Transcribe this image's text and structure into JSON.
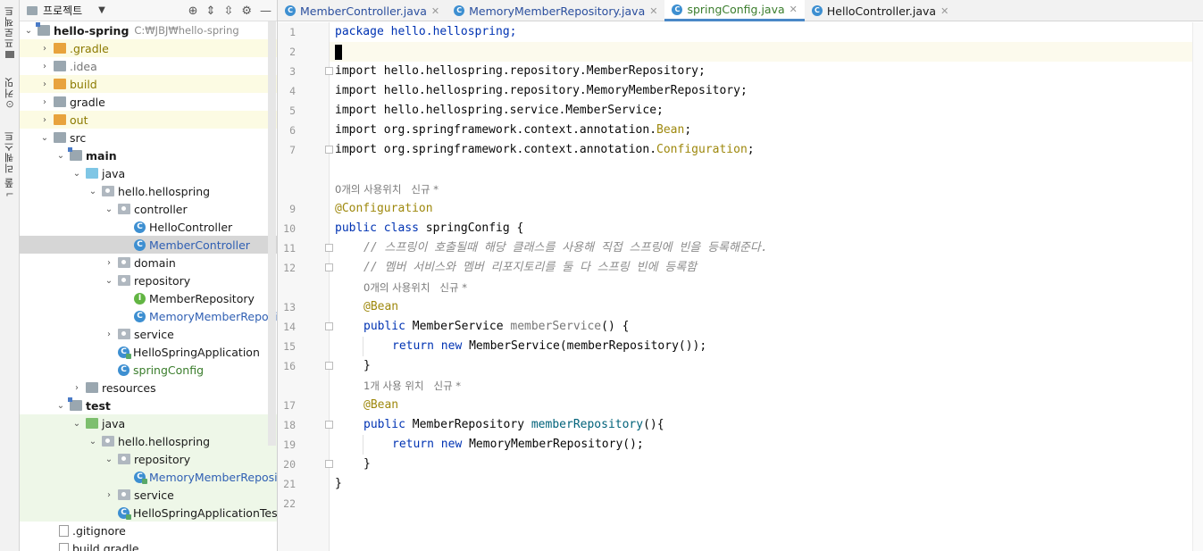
{
  "sidebar_strip": {
    "tabs": [
      {
        "label": "프로젝트"
      },
      {
        "label": "커밋"
      },
      {
        "label": "풀 리퀘스트"
      }
    ]
  },
  "project_panel": {
    "title": "프로젝트",
    "tree": [
      {
        "label": "hello-spring",
        "path": "C:₩JBJ₩hello-spring"
      },
      {
        "label": ".gradle"
      },
      {
        "label": ".idea"
      },
      {
        "label": "build"
      },
      {
        "label": "gradle"
      },
      {
        "label": "out"
      },
      {
        "label": "src"
      },
      {
        "label": "main"
      },
      {
        "label": "java"
      },
      {
        "label": "hello.hellospring"
      },
      {
        "label": "controller"
      },
      {
        "label": "HelloController"
      },
      {
        "label": "MemberController"
      },
      {
        "label": "domain"
      },
      {
        "label": "repository"
      },
      {
        "label": "MemberRepository"
      },
      {
        "label": "MemoryMemberReposito"
      },
      {
        "label": "service"
      },
      {
        "label": "HelloSpringApplication"
      },
      {
        "label": "springConfig"
      },
      {
        "label": "resources"
      },
      {
        "label": "test"
      },
      {
        "label": "java"
      },
      {
        "label": "hello.hellospring"
      },
      {
        "label": "repository"
      },
      {
        "label": "MemoryMemberReposito"
      },
      {
        "label": "service"
      },
      {
        "label": "HelloSpringApplicationTests"
      },
      {
        "label": ".gitignore"
      },
      {
        "label": "build.gradle"
      }
    ]
  },
  "tabs": [
    {
      "label": "MemberController.java"
    },
    {
      "label": "MemoryMemberRepository.java"
    },
    {
      "label": "springConfig.java"
    },
    {
      "label": "HelloController.java"
    }
  ],
  "editor": {
    "line_numbers": [
      "1",
      "2",
      "3",
      "4",
      "5",
      "6",
      "7",
      "9",
      "10",
      "11",
      "12",
      "13",
      "14",
      "15",
      "16",
      "17",
      "18",
      "19",
      "20",
      "21",
      "22"
    ],
    "lines": {
      "l1": "package hello.hellospring;",
      "l3": "import hello.hellospring.repository.MemberRepository;",
      "l4": "import hello.hellospring.repository.MemoryMemberRepository;",
      "l5": "import hello.hellospring.service.MemberService;",
      "l6a": "import org.springframework.context.annotation.",
      "l6b": "Bean",
      "l7a": "import org.springframework.context.annotation.",
      "l7b": "Configuration",
      "hint1": "0개의 사용위치   신규 *",
      "l9": "@Configuration",
      "l10a": "public class ",
      "l10b": "springConfig {",
      "l11": "// 스프링이 호출될때 해당 클래스를 사용해 직접 스프링에 빈을 등록해준다.",
      "l12": "// 멤버 서비스와 멤버 리포지토리를 둘 다 스프링 빈에 등록함",
      "hint2": "0개의 사용위치   신규 *",
      "l13": "@Bean",
      "l14a": "public ",
      "l14b": "MemberService ",
      "l14c": "memberService",
      "l14d": "() {",
      "l15a": "return new ",
      "l15b": "MemberService(memberRepository());",
      "l16": "}",
      "hint3": "1개 사용 위치   신규 *",
      "l17": "@Bean",
      "l18a": "public ",
      "l18b": "MemberRepository ",
      "l18c": "memberRepository",
      "l18d": "(){",
      "l19a": "return new ",
      "l19b": "MemoryMemberRepository();",
      "l20": "}",
      "l21": "}"
    }
  }
}
